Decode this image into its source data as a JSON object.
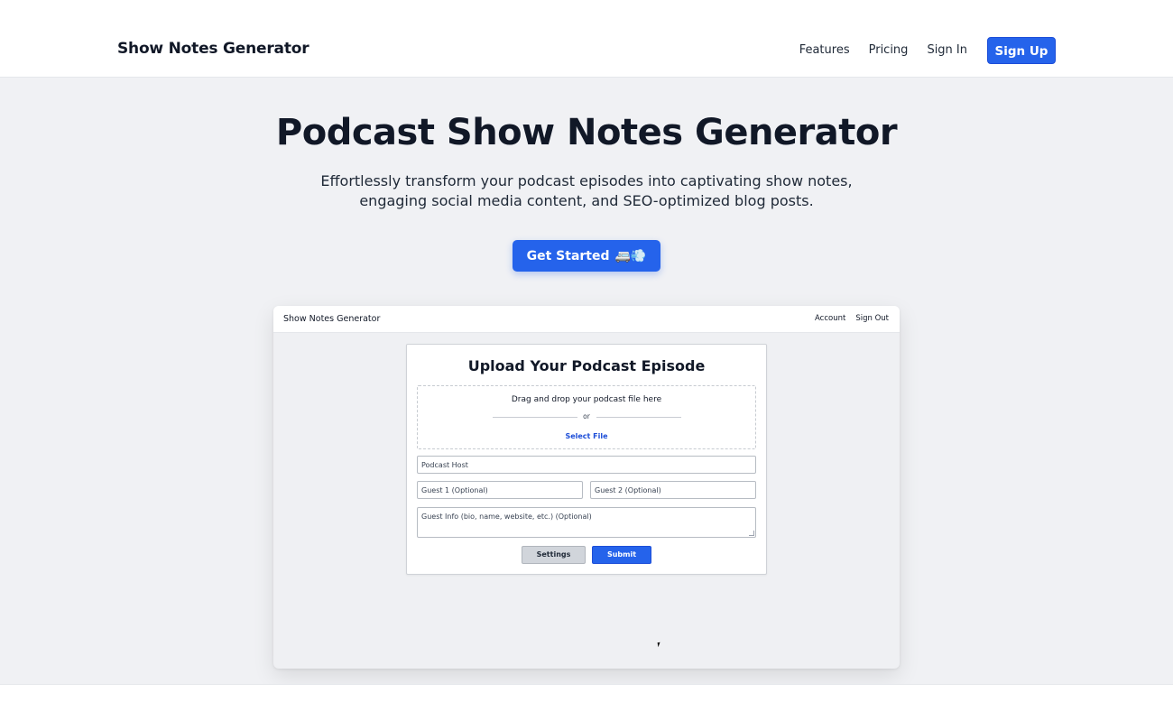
{
  "site": {
    "brand": "Show Notes Generator",
    "nav": {
      "links": [
        "Features",
        "Pricing",
        "Sign In"
      ],
      "cta": "Sign Up"
    }
  },
  "hero": {
    "title": "Podcast Show Notes Generator",
    "subtitle": "Effortlessly transform your podcast episodes into captivating show notes, engaging social media content, and SEO-optimized blog posts.",
    "cta_label": "Get Started",
    "cta_emoji": "🚐💨"
  },
  "preview": {
    "brand": "Show Notes Generator",
    "links": [
      "Account",
      "Sign Out"
    ],
    "card": {
      "title": "Upload Your Podcast Episode",
      "dropzone": {
        "text": "Drag and drop your podcast file here",
        "or": "or",
        "select": "Select File"
      },
      "fields": {
        "host": "Podcast Host",
        "guest1": "Guest 1 (Optional)",
        "guest2": "Guest 2 (Optional)",
        "guest_info": "Guest Info (bio, name, website, etc.) (Optional)"
      },
      "buttons": {
        "settings": "Settings",
        "submit": "Submit"
      }
    }
  },
  "colors": {
    "accent": "#2563eb",
    "hero_bg": "#f0f1f4"
  }
}
